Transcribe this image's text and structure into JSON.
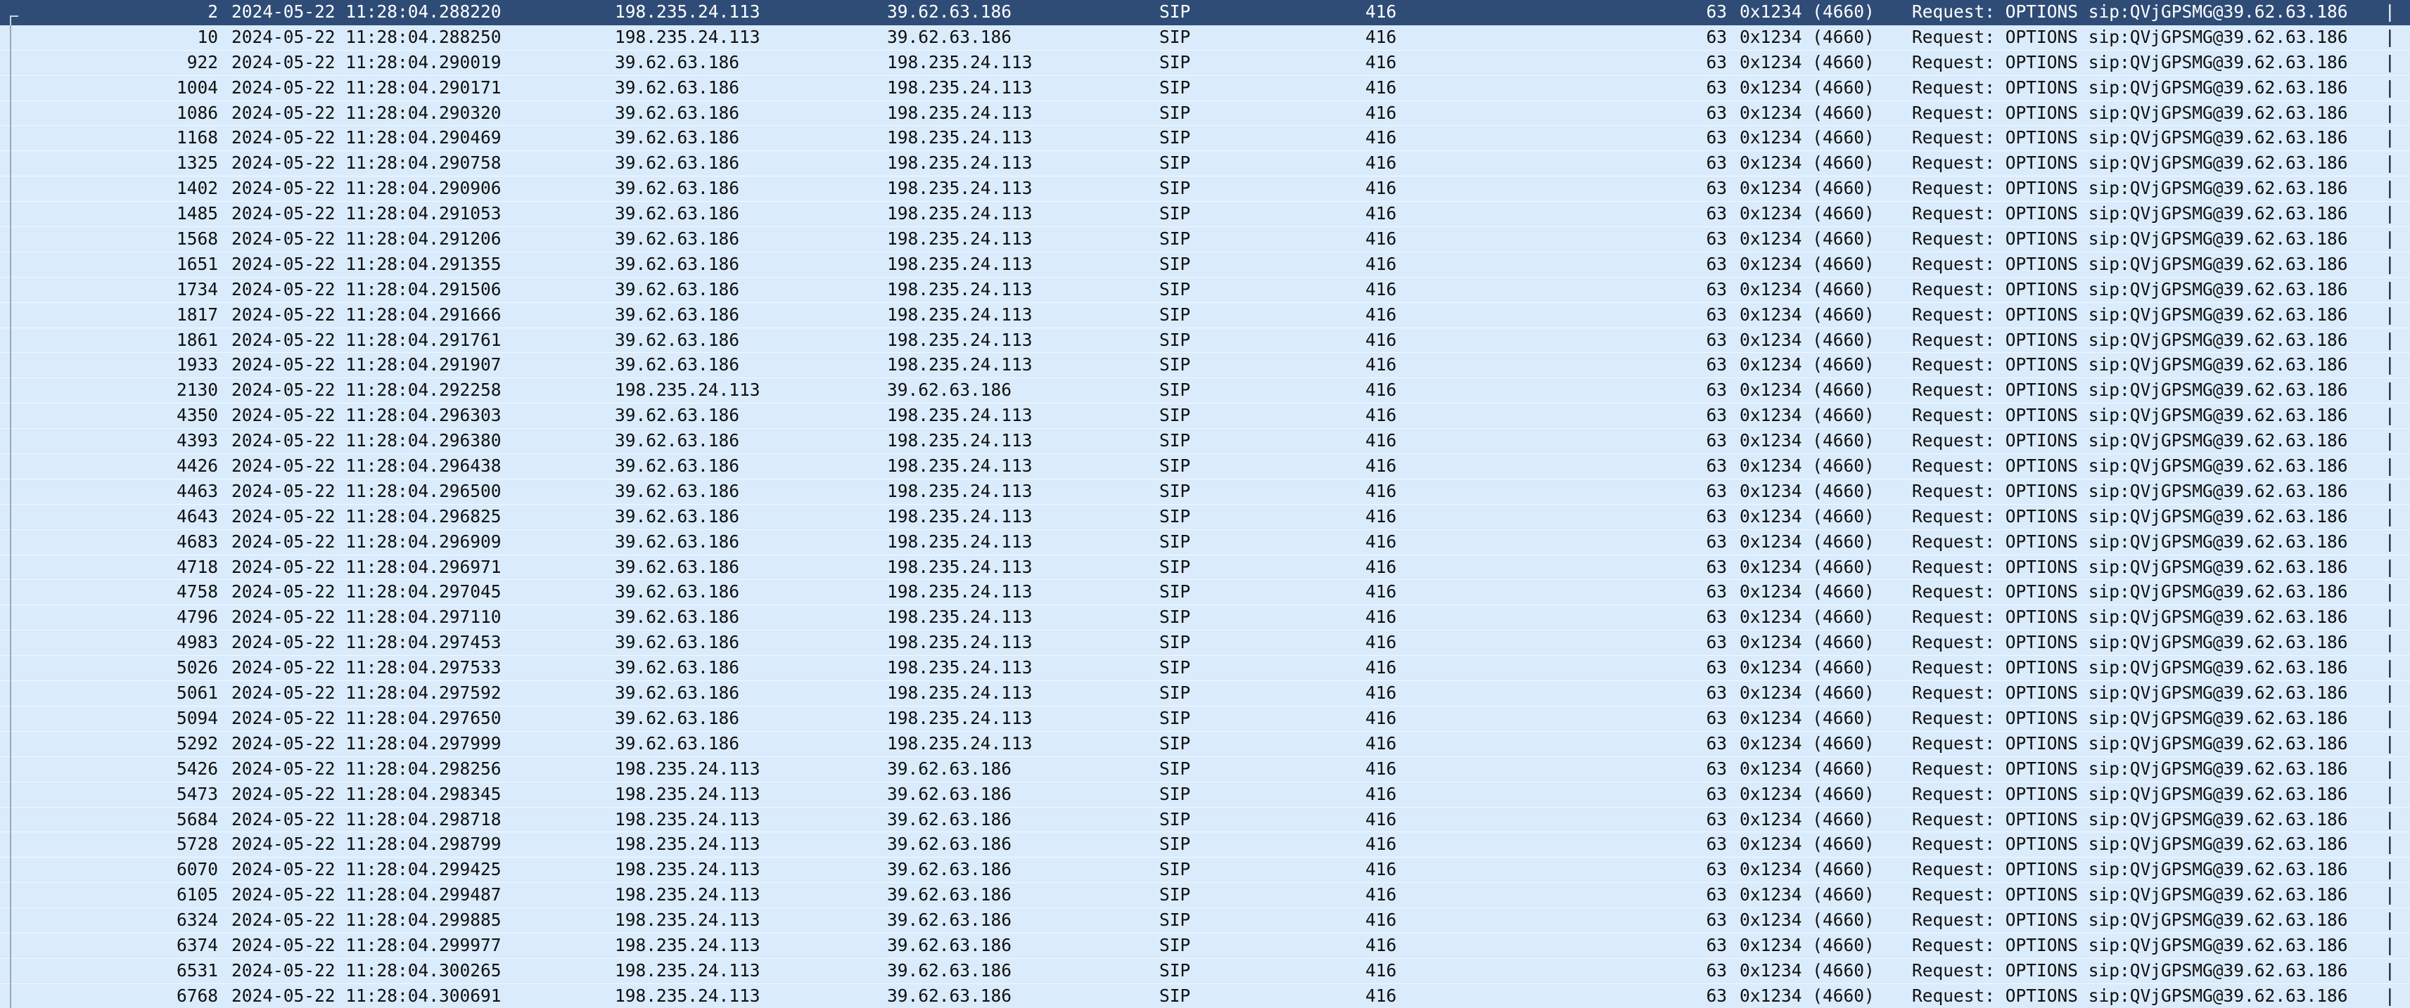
{
  "packet_list": {
    "selected_index": 0,
    "rows": [
      {
        "no": "2",
        "time": "2024-05-22 11:28:04.288220",
        "src": "198.235.24.113",
        "dst": "39.62.63.186",
        "proto": "SIP",
        "length": "416",
        "sport": "63",
        "callid": "0x1234 (4660)",
        "info": "Request: OPTIONS sip:QVjGPSMG@39.62.63.186",
        "end": "|"
      },
      {
        "no": "10",
        "time": "2024-05-22 11:28:04.288250",
        "src": "198.235.24.113",
        "dst": "39.62.63.186",
        "proto": "SIP",
        "length": "416",
        "sport": "63",
        "callid": "0x1234 (4660)",
        "info": "Request: OPTIONS sip:QVjGPSMG@39.62.63.186",
        "end": "|"
      },
      {
        "no": "922",
        "time": "2024-05-22 11:28:04.290019",
        "src": "39.62.63.186",
        "dst": "198.235.24.113",
        "proto": "SIP",
        "length": "416",
        "sport": "63",
        "callid": "0x1234 (4660)",
        "info": "Request: OPTIONS sip:QVjGPSMG@39.62.63.186",
        "end": "|"
      },
      {
        "no": "1004",
        "time": "2024-05-22 11:28:04.290171",
        "src": "39.62.63.186",
        "dst": "198.235.24.113",
        "proto": "SIP",
        "length": "416",
        "sport": "63",
        "callid": "0x1234 (4660)",
        "info": "Request: OPTIONS sip:QVjGPSMG@39.62.63.186",
        "end": "|"
      },
      {
        "no": "1086",
        "time": "2024-05-22 11:28:04.290320",
        "src": "39.62.63.186",
        "dst": "198.235.24.113",
        "proto": "SIP",
        "length": "416",
        "sport": "63",
        "callid": "0x1234 (4660)",
        "info": "Request: OPTIONS sip:QVjGPSMG@39.62.63.186",
        "end": "|"
      },
      {
        "no": "1168",
        "time": "2024-05-22 11:28:04.290469",
        "src": "39.62.63.186",
        "dst": "198.235.24.113",
        "proto": "SIP",
        "length": "416",
        "sport": "63",
        "callid": "0x1234 (4660)",
        "info": "Request: OPTIONS sip:QVjGPSMG@39.62.63.186",
        "end": "|"
      },
      {
        "no": "1325",
        "time": "2024-05-22 11:28:04.290758",
        "src": "39.62.63.186",
        "dst": "198.235.24.113",
        "proto": "SIP",
        "length": "416",
        "sport": "63",
        "callid": "0x1234 (4660)",
        "info": "Request: OPTIONS sip:QVjGPSMG@39.62.63.186",
        "end": "|"
      },
      {
        "no": "1402",
        "time": "2024-05-22 11:28:04.290906",
        "src": "39.62.63.186",
        "dst": "198.235.24.113",
        "proto": "SIP",
        "length": "416",
        "sport": "63",
        "callid": "0x1234 (4660)",
        "info": "Request: OPTIONS sip:QVjGPSMG@39.62.63.186",
        "end": "|"
      },
      {
        "no": "1485",
        "time": "2024-05-22 11:28:04.291053",
        "src": "39.62.63.186",
        "dst": "198.235.24.113",
        "proto": "SIP",
        "length": "416",
        "sport": "63",
        "callid": "0x1234 (4660)",
        "info": "Request: OPTIONS sip:QVjGPSMG@39.62.63.186",
        "end": "|"
      },
      {
        "no": "1568",
        "time": "2024-05-22 11:28:04.291206",
        "src": "39.62.63.186",
        "dst": "198.235.24.113",
        "proto": "SIP",
        "length": "416",
        "sport": "63",
        "callid": "0x1234 (4660)",
        "info": "Request: OPTIONS sip:QVjGPSMG@39.62.63.186",
        "end": "|"
      },
      {
        "no": "1651",
        "time": "2024-05-22 11:28:04.291355",
        "src": "39.62.63.186",
        "dst": "198.235.24.113",
        "proto": "SIP",
        "length": "416",
        "sport": "63",
        "callid": "0x1234 (4660)",
        "info": "Request: OPTIONS sip:QVjGPSMG@39.62.63.186",
        "end": "|"
      },
      {
        "no": "1734",
        "time": "2024-05-22 11:28:04.291506",
        "src": "39.62.63.186",
        "dst": "198.235.24.113",
        "proto": "SIP",
        "length": "416",
        "sport": "63",
        "callid": "0x1234 (4660)",
        "info": "Request: OPTIONS sip:QVjGPSMG@39.62.63.186",
        "end": "|"
      },
      {
        "no": "1817",
        "time": "2024-05-22 11:28:04.291666",
        "src": "39.62.63.186",
        "dst": "198.235.24.113",
        "proto": "SIP",
        "length": "416",
        "sport": "63",
        "callid": "0x1234 (4660)",
        "info": "Request: OPTIONS sip:QVjGPSMG@39.62.63.186",
        "end": "|"
      },
      {
        "no": "1861",
        "time": "2024-05-22 11:28:04.291761",
        "src": "39.62.63.186",
        "dst": "198.235.24.113",
        "proto": "SIP",
        "length": "416",
        "sport": "63",
        "callid": "0x1234 (4660)",
        "info": "Request: OPTIONS sip:QVjGPSMG@39.62.63.186",
        "end": "|"
      },
      {
        "no": "1933",
        "time": "2024-05-22 11:28:04.291907",
        "src": "39.62.63.186",
        "dst": "198.235.24.113",
        "proto": "SIP",
        "length": "416",
        "sport": "63",
        "callid": "0x1234 (4660)",
        "info": "Request: OPTIONS sip:QVjGPSMG@39.62.63.186",
        "end": "|"
      },
      {
        "no": "2130",
        "time": "2024-05-22 11:28:04.292258",
        "src": "198.235.24.113",
        "dst": "39.62.63.186",
        "proto": "SIP",
        "length": "416",
        "sport": "63",
        "callid": "0x1234 (4660)",
        "info": "Request: OPTIONS sip:QVjGPSMG@39.62.63.186",
        "end": "|"
      },
      {
        "no": "4350",
        "time": "2024-05-22 11:28:04.296303",
        "src": "39.62.63.186",
        "dst": "198.235.24.113",
        "proto": "SIP",
        "length": "416",
        "sport": "63",
        "callid": "0x1234 (4660)",
        "info": "Request: OPTIONS sip:QVjGPSMG@39.62.63.186",
        "end": "|"
      },
      {
        "no": "4393",
        "time": "2024-05-22 11:28:04.296380",
        "src": "39.62.63.186",
        "dst": "198.235.24.113",
        "proto": "SIP",
        "length": "416",
        "sport": "63",
        "callid": "0x1234 (4660)",
        "info": "Request: OPTIONS sip:QVjGPSMG@39.62.63.186",
        "end": "|"
      },
      {
        "no": "4426",
        "time": "2024-05-22 11:28:04.296438",
        "src": "39.62.63.186",
        "dst": "198.235.24.113",
        "proto": "SIP",
        "length": "416",
        "sport": "63",
        "callid": "0x1234 (4660)",
        "info": "Request: OPTIONS sip:QVjGPSMG@39.62.63.186",
        "end": "|"
      },
      {
        "no": "4463",
        "time": "2024-05-22 11:28:04.296500",
        "src": "39.62.63.186",
        "dst": "198.235.24.113",
        "proto": "SIP",
        "length": "416",
        "sport": "63",
        "callid": "0x1234 (4660)",
        "info": "Request: OPTIONS sip:QVjGPSMG@39.62.63.186",
        "end": "|"
      },
      {
        "no": "4643",
        "time": "2024-05-22 11:28:04.296825",
        "src": "39.62.63.186",
        "dst": "198.235.24.113",
        "proto": "SIP",
        "length": "416",
        "sport": "63",
        "callid": "0x1234 (4660)",
        "info": "Request: OPTIONS sip:QVjGPSMG@39.62.63.186",
        "end": "|"
      },
      {
        "no": "4683",
        "time": "2024-05-22 11:28:04.296909",
        "src": "39.62.63.186",
        "dst": "198.235.24.113",
        "proto": "SIP",
        "length": "416",
        "sport": "63",
        "callid": "0x1234 (4660)",
        "info": "Request: OPTIONS sip:QVjGPSMG@39.62.63.186",
        "end": "|"
      },
      {
        "no": "4718",
        "time": "2024-05-22 11:28:04.296971",
        "src": "39.62.63.186",
        "dst": "198.235.24.113",
        "proto": "SIP",
        "length": "416",
        "sport": "63",
        "callid": "0x1234 (4660)",
        "info": "Request: OPTIONS sip:QVjGPSMG@39.62.63.186",
        "end": "|"
      },
      {
        "no": "4758",
        "time": "2024-05-22 11:28:04.297045",
        "src": "39.62.63.186",
        "dst": "198.235.24.113",
        "proto": "SIP",
        "length": "416",
        "sport": "63",
        "callid": "0x1234 (4660)",
        "info": "Request: OPTIONS sip:QVjGPSMG@39.62.63.186",
        "end": "|"
      },
      {
        "no": "4796",
        "time": "2024-05-22 11:28:04.297110",
        "src": "39.62.63.186",
        "dst": "198.235.24.113",
        "proto": "SIP",
        "length": "416",
        "sport": "63",
        "callid": "0x1234 (4660)",
        "info": "Request: OPTIONS sip:QVjGPSMG@39.62.63.186",
        "end": "|"
      },
      {
        "no": "4983",
        "time": "2024-05-22 11:28:04.297453",
        "src": "39.62.63.186",
        "dst": "198.235.24.113",
        "proto": "SIP",
        "length": "416",
        "sport": "63",
        "callid": "0x1234 (4660)",
        "info": "Request: OPTIONS sip:QVjGPSMG@39.62.63.186",
        "end": "|"
      },
      {
        "no": "5026",
        "time": "2024-05-22 11:28:04.297533",
        "src": "39.62.63.186",
        "dst": "198.235.24.113",
        "proto": "SIP",
        "length": "416",
        "sport": "63",
        "callid": "0x1234 (4660)",
        "info": "Request: OPTIONS sip:QVjGPSMG@39.62.63.186",
        "end": "|"
      },
      {
        "no": "5061",
        "time": "2024-05-22 11:28:04.297592",
        "src": "39.62.63.186",
        "dst": "198.235.24.113",
        "proto": "SIP",
        "length": "416",
        "sport": "63",
        "callid": "0x1234 (4660)",
        "info": "Request: OPTIONS sip:QVjGPSMG@39.62.63.186",
        "end": "|"
      },
      {
        "no": "5094",
        "time": "2024-05-22 11:28:04.297650",
        "src": "39.62.63.186",
        "dst": "198.235.24.113",
        "proto": "SIP",
        "length": "416",
        "sport": "63",
        "callid": "0x1234 (4660)",
        "info": "Request: OPTIONS sip:QVjGPSMG@39.62.63.186",
        "end": "|"
      },
      {
        "no": "5292",
        "time": "2024-05-22 11:28:04.297999",
        "src": "39.62.63.186",
        "dst": "198.235.24.113",
        "proto": "SIP",
        "length": "416",
        "sport": "63",
        "callid": "0x1234 (4660)",
        "info": "Request: OPTIONS sip:QVjGPSMG@39.62.63.186",
        "end": "|"
      },
      {
        "no": "5426",
        "time": "2024-05-22 11:28:04.298256",
        "src": "198.235.24.113",
        "dst": "39.62.63.186",
        "proto": "SIP",
        "length": "416",
        "sport": "63",
        "callid": "0x1234 (4660)",
        "info": "Request: OPTIONS sip:QVjGPSMG@39.62.63.186",
        "end": "|"
      },
      {
        "no": "5473",
        "time": "2024-05-22 11:28:04.298345",
        "src": "198.235.24.113",
        "dst": "39.62.63.186",
        "proto": "SIP",
        "length": "416",
        "sport": "63",
        "callid": "0x1234 (4660)",
        "info": "Request: OPTIONS sip:QVjGPSMG@39.62.63.186",
        "end": "|"
      },
      {
        "no": "5684",
        "time": "2024-05-22 11:28:04.298718",
        "src": "198.235.24.113",
        "dst": "39.62.63.186",
        "proto": "SIP",
        "length": "416",
        "sport": "63",
        "callid": "0x1234 (4660)",
        "info": "Request: OPTIONS sip:QVjGPSMG@39.62.63.186",
        "end": "|"
      },
      {
        "no": "5728",
        "time": "2024-05-22 11:28:04.298799",
        "src": "198.235.24.113",
        "dst": "39.62.63.186",
        "proto": "SIP",
        "length": "416",
        "sport": "63",
        "callid": "0x1234 (4660)",
        "info": "Request: OPTIONS sip:QVjGPSMG@39.62.63.186",
        "end": "|"
      },
      {
        "no": "6070",
        "time": "2024-05-22 11:28:04.299425",
        "src": "198.235.24.113",
        "dst": "39.62.63.186",
        "proto": "SIP",
        "length": "416",
        "sport": "63",
        "callid": "0x1234 (4660)",
        "info": "Request: OPTIONS sip:QVjGPSMG@39.62.63.186",
        "end": "|"
      },
      {
        "no": "6105",
        "time": "2024-05-22 11:28:04.299487",
        "src": "198.235.24.113",
        "dst": "39.62.63.186",
        "proto": "SIP",
        "length": "416",
        "sport": "63",
        "callid": "0x1234 (4660)",
        "info": "Request: OPTIONS sip:QVjGPSMG@39.62.63.186",
        "end": "|"
      },
      {
        "no": "6324",
        "time": "2024-05-22 11:28:04.299885",
        "src": "198.235.24.113",
        "dst": "39.62.63.186",
        "proto": "SIP",
        "length": "416",
        "sport": "63",
        "callid": "0x1234 (4660)",
        "info": "Request: OPTIONS sip:QVjGPSMG@39.62.63.186",
        "end": "|"
      },
      {
        "no": "6374",
        "time": "2024-05-22 11:28:04.299977",
        "src": "198.235.24.113",
        "dst": "39.62.63.186",
        "proto": "SIP",
        "length": "416",
        "sport": "63",
        "callid": "0x1234 (4660)",
        "info": "Request: OPTIONS sip:QVjGPSMG@39.62.63.186",
        "end": "|"
      },
      {
        "no": "6531",
        "time": "2024-05-22 11:28:04.300265",
        "src": "198.235.24.113",
        "dst": "39.62.63.186",
        "proto": "SIP",
        "length": "416",
        "sport": "63",
        "callid": "0x1234 (4660)",
        "info": "Request: OPTIONS sip:QVjGPSMG@39.62.63.186",
        "end": "|"
      },
      {
        "no": "6768",
        "time": "2024-05-22 11:28:04.300691",
        "src": "198.235.24.113",
        "dst": "39.62.63.186",
        "proto": "SIP",
        "length": "416",
        "sport": "63",
        "callid": "0x1234 (4660)",
        "info": "Request: OPTIONS sip:QVjGPSMG@39.62.63.186",
        "end": "|"
      }
    ]
  },
  "colors": {
    "row_background": "#daebfc",
    "selected_background": "#2f4c77",
    "row_separator": "#f3f8fe"
  }
}
